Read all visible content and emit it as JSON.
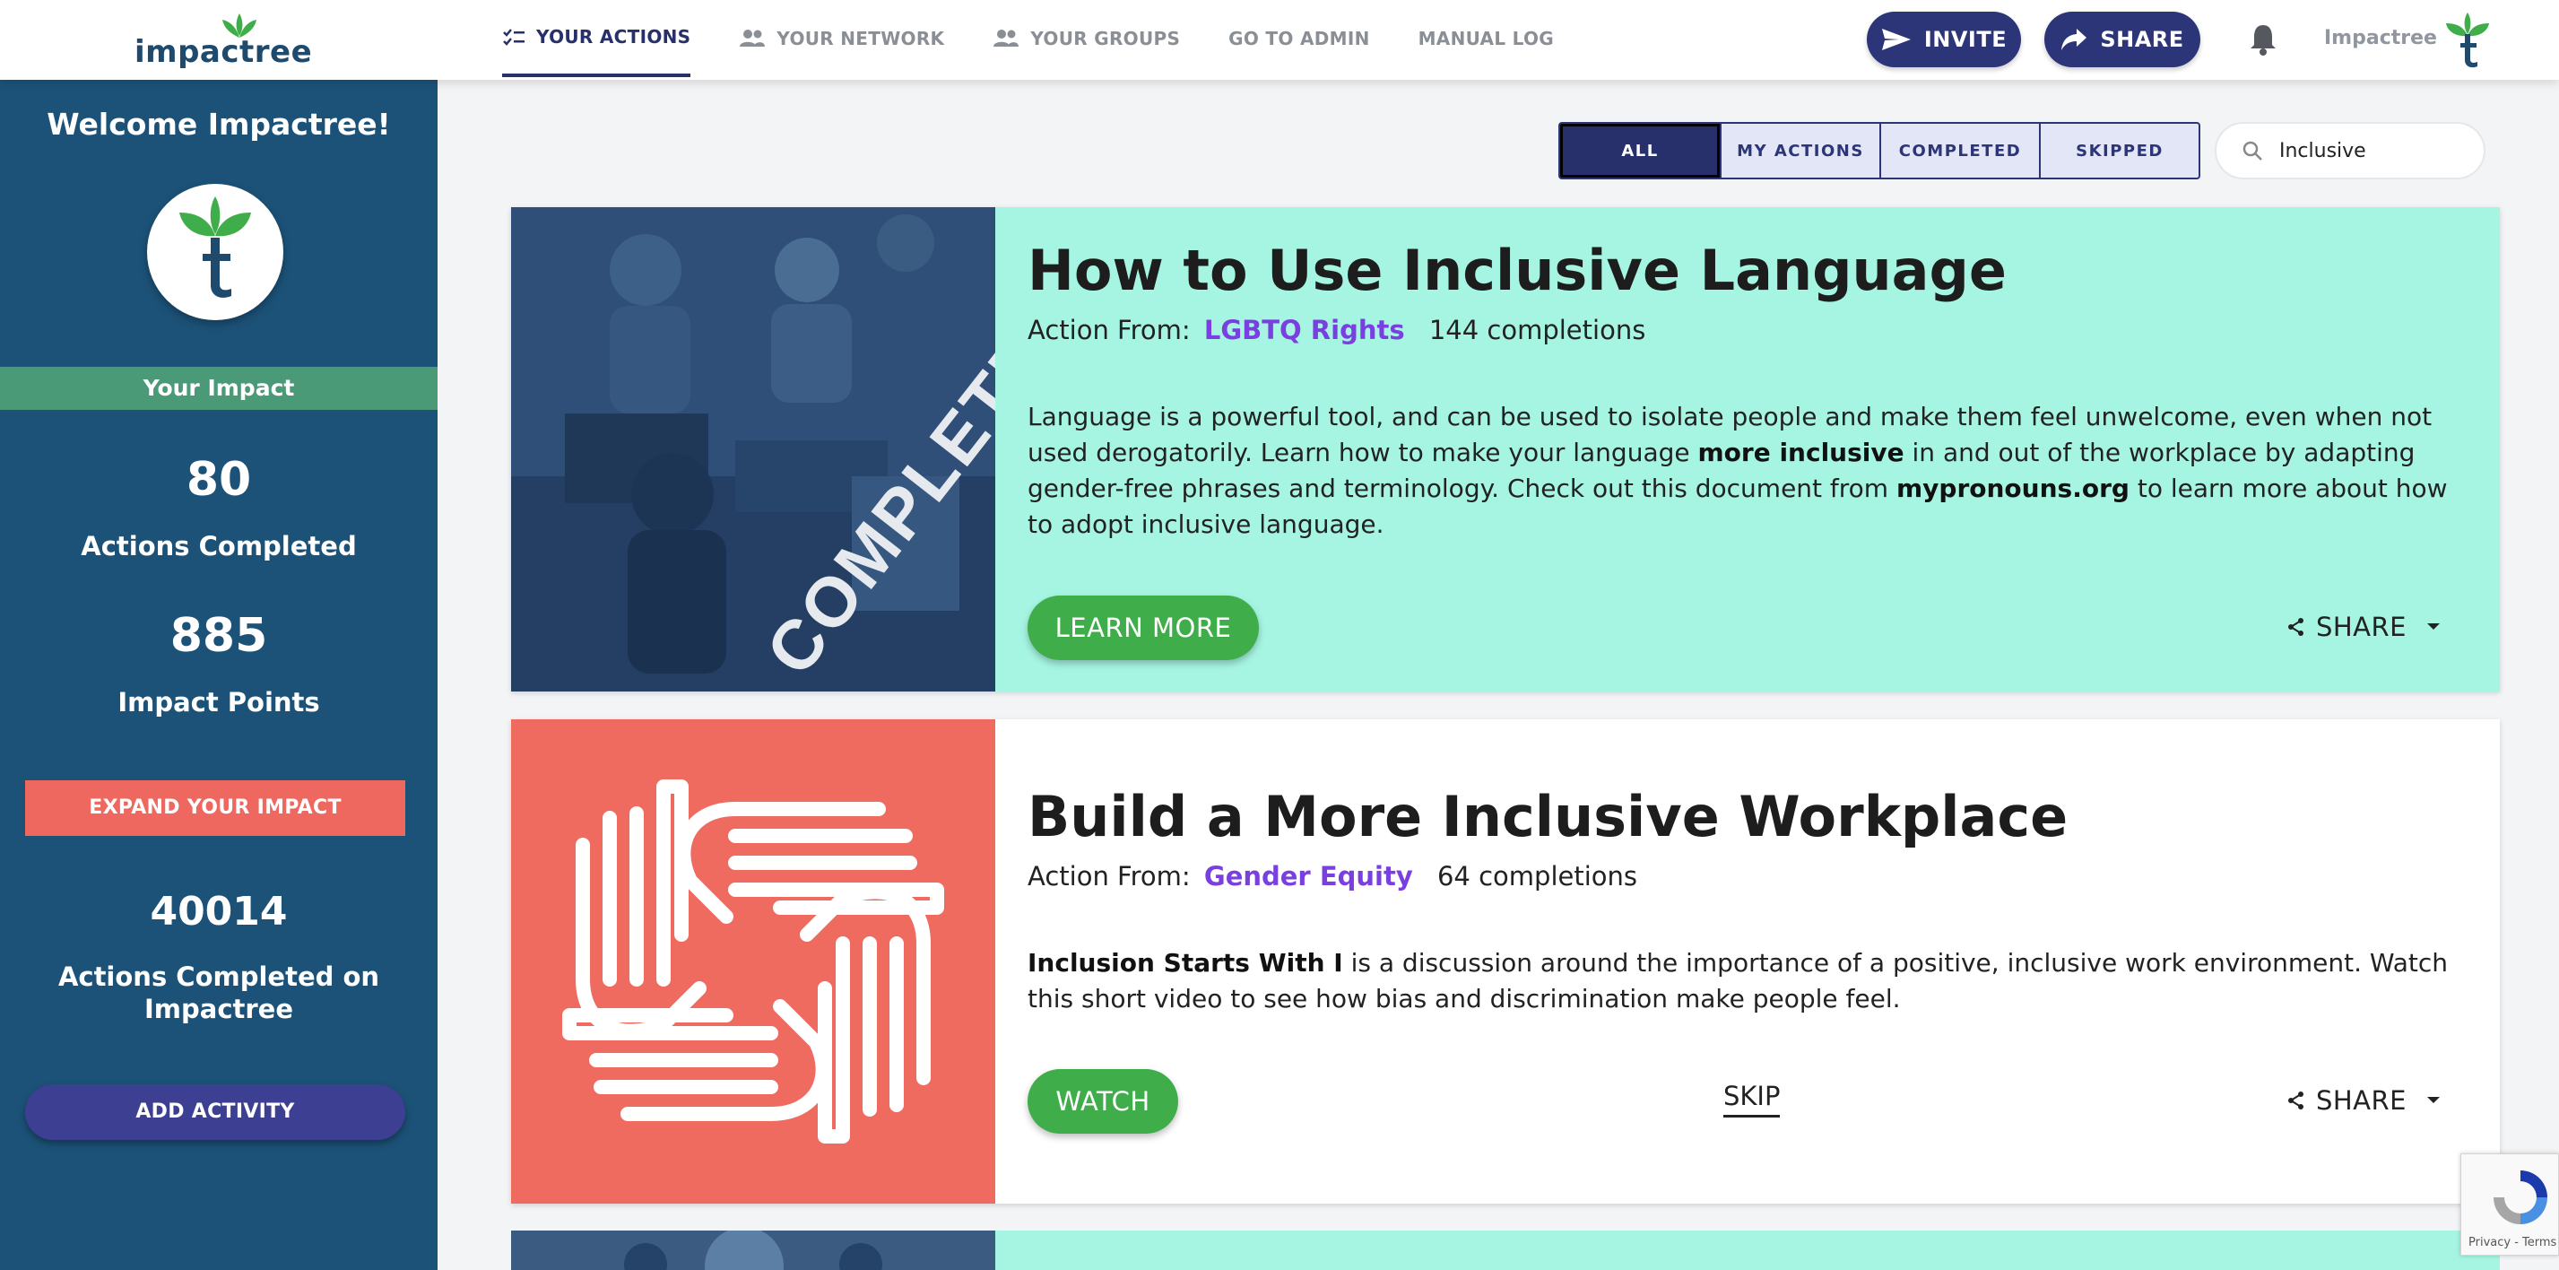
{
  "brand": {
    "name": "impactree"
  },
  "nav": {
    "items": [
      {
        "label": "YOUR ACTIONS",
        "active": true
      },
      {
        "label": "YOUR NETWORK"
      },
      {
        "label": "YOUR GROUPS"
      },
      {
        "label": "GO TO ADMIN"
      },
      {
        "label": "MANUAL LOG"
      }
    ],
    "invite_label": "INVITE",
    "share_label": "SHARE",
    "username": "Impactree"
  },
  "sidebar": {
    "welcome": "Welcome Impactree!",
    "impact_heading": "Your Impact",
    "actions_completed_value": "80",
    "actions_completed_label": "Actions Completed",
    "impact_points_value": "885",
    "impact_points_label": "Impact Points",
    "expand_label": "EXPAND YOUR IMPACT",
    "global_value": "40014",
    "global_label": "Actions Completed on Impactree",
    "add_activity_label": "ADD ACTIVITY"
  },
  "filters": {
    "options": [
      "ALL",
      "MY ACTIONS",
      "COMPLETED",
      "SKIPPED"
    ],
    "selected": "ALL"
  },
  "search": {
    "value": "Inclusive"
  },
  "cards": [
    {
      "title": "How to Use Inclusive Language",
      "action_from_label": "Action From:",
      "cause": "LGBTQ Rights",
      "completions": "144 completions",
      "desc_parts": [
        "Language is a powerful tool, and can be used to isolate people and make them feel unwelcome, even when not used derogatorily. Learn how to make your language ",
        "more inclusive",
        " in and out of the workplace by adapting gender-free phrases and terminology. Check out this document from ",
        "mypronouns.org",
        " to learn more about how to adopt inclusive language."
      ],
      "button_label": "LEARN MORE",
      "share_label": "SHARE",
      "overlay_label": "COMPLETED",
      "background": "#a6f5e2"
    },
    {
      "title": "Build a More Inclusive Workplace",
      "action_from_label": "Action From:",
      "cause": "Gender Equity",
      "completions": "64 completions",
      "desc_parts": [
        "Inclusion Starts With I",
        " is a discussion around the importance of a positive, inclusive work environment. Watch this short video to see how bias and discrimination make people feel."
      ],
      "button_label": "WATCH",
      "skip_label": "SKIP",
      "share_label": "SHARE",
      "background": "#ffffff",
      "media_color": "#ef6a5f"
    }
  ],
  "recaptcha": {
    "text": "Privacy - Terms"
  },
  "colors": {
    "navy": "#27306b",
    "sidebar": "#1c5278",
    "green": "#3fae4a",
    "cause": "#7a3fe0",
    "mint": "#a6f5e2",
    "coral": "#ef6a5f"
  }
}
